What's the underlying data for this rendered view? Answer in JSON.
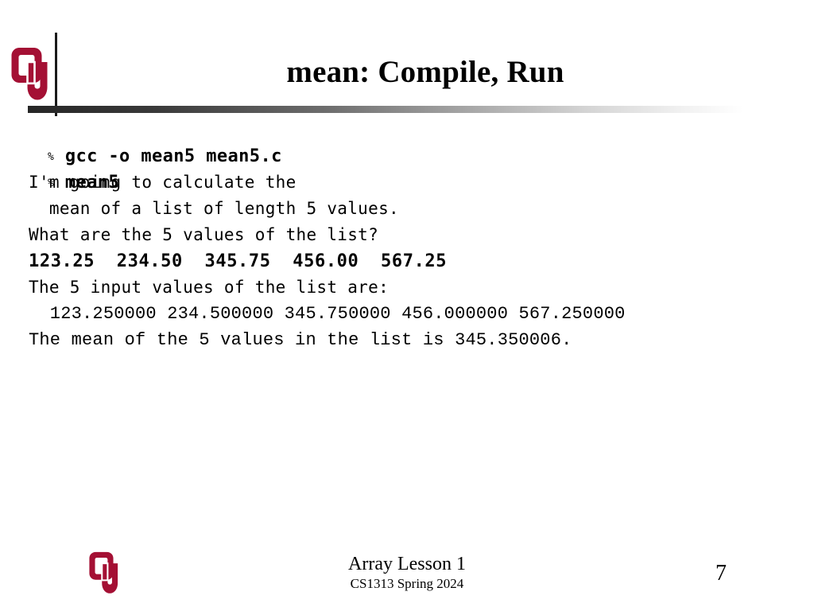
{
  "slide": {
    "title": "mean: Compile, Run",
    "page_number": "7",
    "accent_color": "#A41034",
    "rule_color": "#262626",
    "background": "#FFFFFF"
  },
  "logo": {
    "name": "ou-logo",
    "alt_text": "OU",
    "color": "#A41034"
  },
  "transcript": {
    "prompt_symbol": "%",
    "lines": [
      {
        "kind": "command",
        "prompt": "%",
        "text": "gcc -o mean5 mean5.c"
      },
      {
        "kind": "command",
        "prompt": "%",
        "text": "mean5"
      },
      {
        "kind": "output",
        "text": "I'm going to calculate the"
      },
      {
        "kind": "output",
        "text": "  mean of a list of length 5 values."
      },
      {
        "kind": "output",
        "text": "What are the 5 values of the list?"
      },
      {
        "kind": "input",
        "text": "123.25  234.50  345.75  456.00  567.25"
      },
      {
        "kind": "output",
        "text": "The 5 input values of the list are:"
      },
      {
        "kind": "output-narrow",
        "text": "  123.250000 234.500000 345.750000 456.000000 567.250000"
      },
      {
        "kind": "output-narrow",
        "text": "The mean of the 5 values in the list is 345.350006."
      }
    ]
  },
  "footer": {
    "lesson": "Array Lesson 1",
    "course": "CS1313 Spring 2024"
  }
}
